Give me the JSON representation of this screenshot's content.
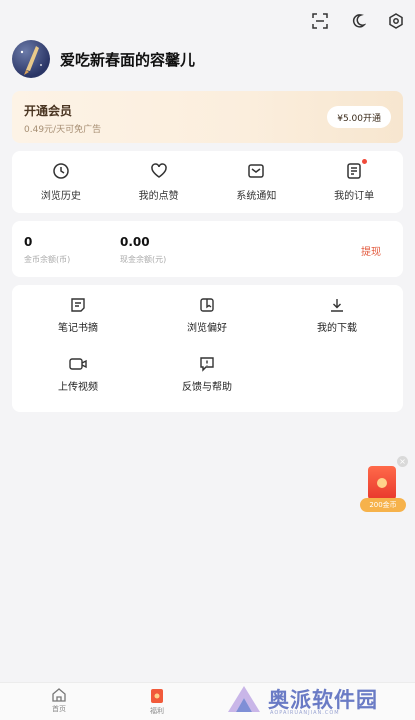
{
  "profile": {
    "username": "爱吃新春面的容馨儿"
  },
  "vip": {
    "title": "开通会员",
    "subtitle": "0.49元/天可免广告",
    "button": "¥5.00开通"
  },
  "quick": [
    {
      "label": "浏览历史",
      "icon": "clock-icon"
    },
    {
      "label": "我的点赞",
      "icon": "heart-icon"
    },
    {
      "label": "系统通知",
      "icon": "mail-icon"
    },
    {
      "label": "我的订单",
      "icon": "order-icon",
      "badge": true
    }
  ],
  "balance": {
    "coin_value": "0",
    "coin_caption": "金币余额(币)",
    "cash_value": "0.00",
    "cash_caption": "现金余额(元)",
    "withdraw": "提现"
  },
  "tools": [
    {
      "label": "笔记书摘",
      "icon": "note-icon"
    },
    {
      "label": "浏览偏好",
      "icon": "book-icon"
    },
    {
      "label": "我的下载",
      "icon": "download-icon"
    },
    {
      "label": "上传视频",
      "icon": "video-icon"
    },
    {
      "label": "反馈与帮助",
      "icon": "feedback-icon"
    }
  ],
  "redpack": {
    "label": "200金币"
  },
  "tabbar": {
    "home": "首页",
    "welfare": "福利"
  },
  "watermark": {
    "text": "奥派软件园",
    "url": "AOPAIRUANJIAN.COM"
  },
  "colors": {
    "accent": "#e35b3f",
    "vip_bg": "#fbeedd",
    "watermark": "#6a7bc5"
  }
}
